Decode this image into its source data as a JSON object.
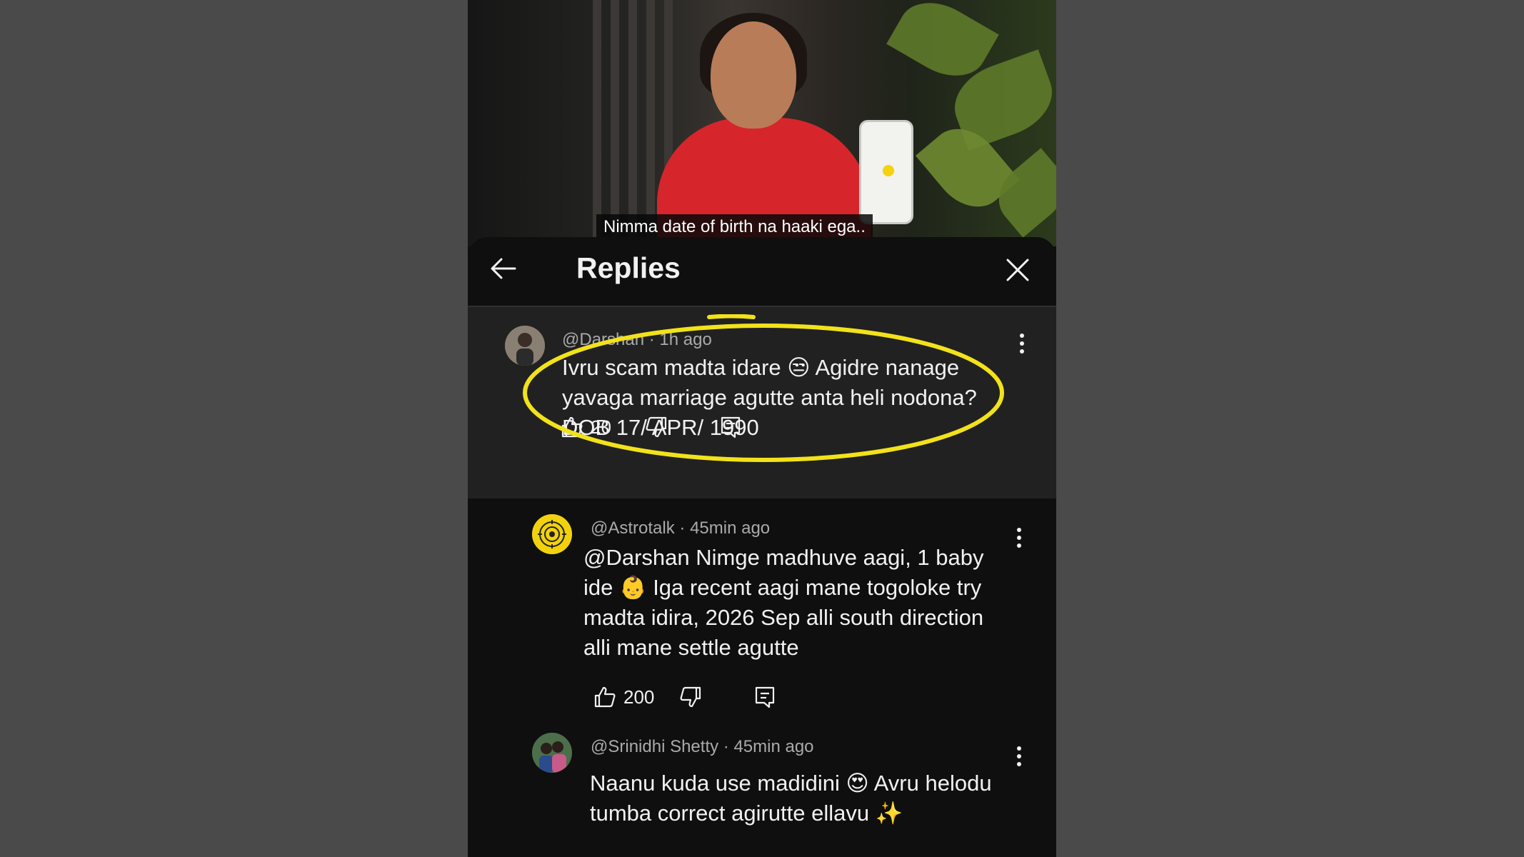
{
  "video": {
    "caption": "Nimma date of birth na haaki ega.."
  },
  "header": {
    "title": "Replies",
    "back_icon": "arrow-left-icon",
    "close_icon": "close-icon"
  },
  "colors": {
    "highlight_ring": "#f2e21a",
    "sheet_bg": "#0f0f0f",
    "parent_bg": "#212121",
    "astrotalk_avatar": "#f2d20d"
  },
  "parent_comment": {
    "author": "@Darshan",
    "time": "1h ago",
    "text": "Ivru scam madta idare 😒 Agidre nanage yavaga marriage agutte anta heli nodona? DOB 17/ APR/ 1990",
    "likes": "20"
  },
  "replies": [
    {
      "author": "@Astrotalk",
      "time": "45min ago",
      "text": "@Darshan   Nimge madhuve aagi, 1 baby ide 👶 Iga recent aagi mane togoloke try madta idira, 2026 Sep alli south direction alli mane settle agutte",
      "likes": "200"
    },
    {
      "author": "@Srinidhi Shetty",
      "time": "45min ago",
      "text": "Naanu kuda use madidini 😍 Avru helodu tumba correct agirutte ellavu ✨"
    }
  ],
  "separator": "·"
}
